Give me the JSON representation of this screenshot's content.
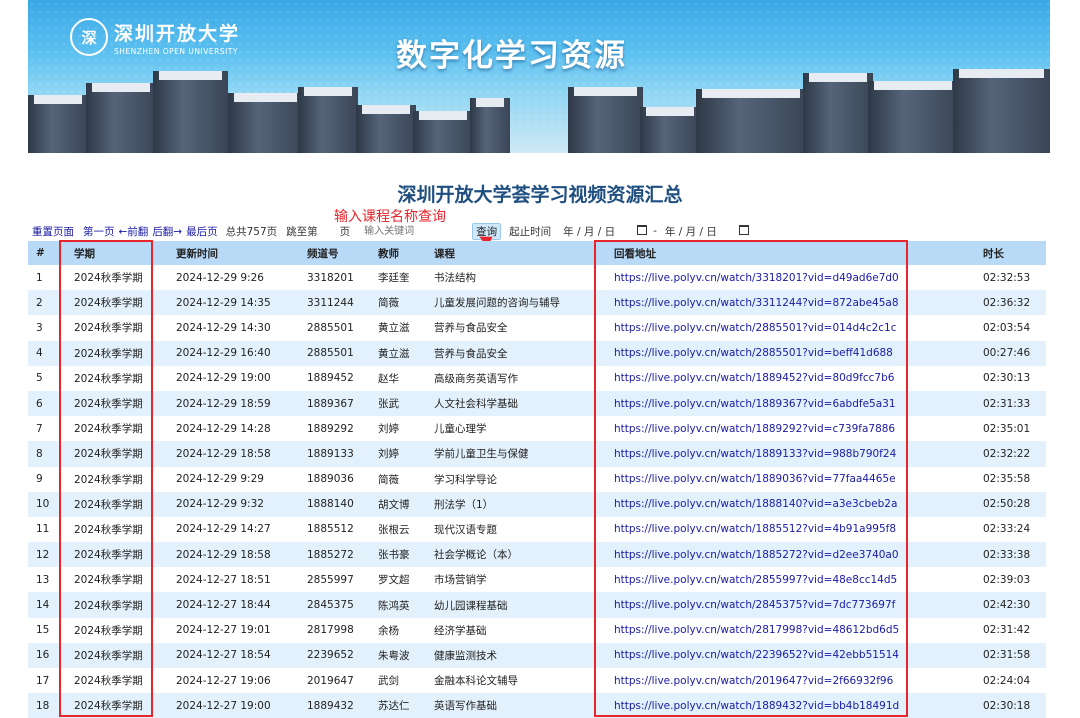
{
  "banner": {
    "logo_seal": "深",
    "logo_cn": "深圳开放大学",
    "logo_en": "SHENZHEN OPEN UNIVERSITY",
    "title": "数字化学习资源"
  },
  "headline": "深圳开放大学荟学习视频资源汇总",
  "toolbar": {
    "reset": "重置页面",
    "first": "第一页",
    "prev": "←前翻",
    "next": "后翻→",
    "last": "最后页",
    "total": "总共757页",
    "jump": "跳至第",
    "page_suffix": "页",
    "keyword_placeholder": "输入关键词",
    "query": "查询",
    "time_label": "起止时间",
    "date_placeholder": "年 / 月 / 日",
    "dash": "-"
  },
  "annotation": "输入课程名称查询",
  "colors": {
    "header": "#b9daf7",
    "row_alt": "#e3f1fc",
    "link": "#1a1aa6",
    "annotation": "#e8242c"
  },
  "table": {
    "headers": [
      "#",
      "学期",
      "更新时间",
      "频道号",
      "教师",
      "课程",
      "回看地址",
      "时长"
    ],
    "rows": [
      [
        "1",
        "2024秋季学期",
        "2024-12-29 9:26",
        "3318201",
        "李廷奎",
        "书法结构",
        "https://live.polyv.cn/watch/3318201?vid=d49ad6e7d0",
        "02:32:53"
      ],
      [
        "2",
        "2024秋季学期",
        "2024-12-29 14:35",
        "3311244",
        "简薇",
        "儿童发展问题的咨询与辅导",
        "https://live.polyv.cn/watch/3311244?vid=872abe45a8",
        "02:36:32"
      ],
      [
        "3",
        "2024秋季学期",
        "2024-12-29 14:30",
        "2885501",
        "黄立滋",
        "营养与食品安全",
        "https://live.polyv.cn/watch/2885501?vid=014d4c2c1c",
        "02:03:54"
      ],
      [
        "4",
        "2024秋季学期",
        "2024-12-29 16:40",
        "2885501",
        "黄立滋",
        "营养与食品安全",
        "https://live.polyv.cn/watch/2885501?vid=beff41d688",
        "00:27:46"
      ],
      [
        "5",
        "2024秋季学期",
        "2024-12-29 19:00",
        "1889452",
        "赵华",
        "高级商务英语写作",
        "https://live.polyv.cn/watch/1889452?vid=80d9fcc7b6",
        "02:30:13"
      ],
      [
        "6",
        "2024秋季学期",
        "2024-12-29 18:59",
        "1889367",
        "张武",
        "人文社会科学基础",
        "https://live.polyv.cn/watch/1889367?vid=6abdfe5a31",
        "02:31:33"
      ],
      [
        "7",
        "2024秋季学期",
        "2024-12-29 14:28",
        "1889292",
        "刘婷",
        "儿童心理学",
        "https://live.polyv.cn/watch/1889292?vid=c739fa7886",
        "02:35:01"
      ],
      [
        "8",
        "2024秋季学期",
        "2024-12-29 18:58",
        "1889133",
        "刘婷",
        "学前儿童卫生与保健",
        "https://live.polyv.cn/watch/1889133?vid=988b790f24",
        "02:32:22"
      ],
      [
        "9",
        "2024秋季学期",
        "2024-12-29 9:29",
        "1889036",
        "简薇",
        "学习科学导论",
        "https://live.polyv.cn/watch/1889036?vid=77faa4465e",
        "02:35:58"
      ],
      [
        "10",
        "2024秋季学期",
        "2024-12-29 9:32",
        "1888140",
        "胡文博",
        "刑法学（1）",
        "https://live.polyv.cn/watch/1888140?vid=a3e3cbeb2a",
        "02:50:28"
      ],
      [
        "11",
        "2024秋季学期",
        "2024-12-29 14:27",
        "1885512",
        "张根云",
        "现代汉语专题",
        "https://live.polyv.cn/watch/1885512?vid=4b91a995f8",
        "02:33:24"
      ],
      [
        "12",
        "2024秋季学期",
        "2024-12-29 18:58",
        "1885272",
        "张书豪",
        "社会学概论（本）",
        "https://live.polyv.cn/watch/1885272?vid=d2ee3740a0",
        "02:33:38"
      ],
      [
        "13",
        "2024秋季学期",
        "2024-12-27 18:51",
        "2855997",
        "罗文超",
        "市场营销学",
        "https://live.polyv.cn/watch/2855997?vid=48e8cc14d5",
        "02:39:03"
      ],
      [
        "14",
        "2024秋季学期",
        "2024-12-27 18:44",
        "2845375",
        "陈鸿英",
        "幼儿园课程基础",
        "https://live.polyv.cn/watch/2845375?vid=7dc773697f",
        "02:42:30"
      ],
      [
        "15",
        "2024秋季学期",
        "2024-12-27 19:01",
        "2817998",
        "余杨",
        "经济学基础",
        "https://live.polyv.cn/watch/2817998?vid=48612bd6d5",
        "02:31:42"
      ],
      [
        "16",
        "2024秋季学期",
        "2024-12-27 18:54",
        "2239652",
        "朱粤波",
        "健康监测技术",
        "https://live.polyv.cn/watch/2239652?vid=42ebb51514",
        "02:31:58"
      ],
      [
        "17",
        "2024秋季学期",
        "2024-12-27 19:06",
        "2019647",
        "武剑",
        "金融本科论文辅导",
        "https://live.polyv.cn/watch/2019647?vid=2f66932f96",
        "02:24:04"
      ],
      [
        "18",
        "2024秋季学期",
        "2024-12-27 19:00",
        "1889432",
        "苏达仁",
        "英语写作基础",
        "https://live.polyv.cn/watch/1889432?vid=bb4b18491d",
        "02:30:18"
      ]
    ]
  }
}
